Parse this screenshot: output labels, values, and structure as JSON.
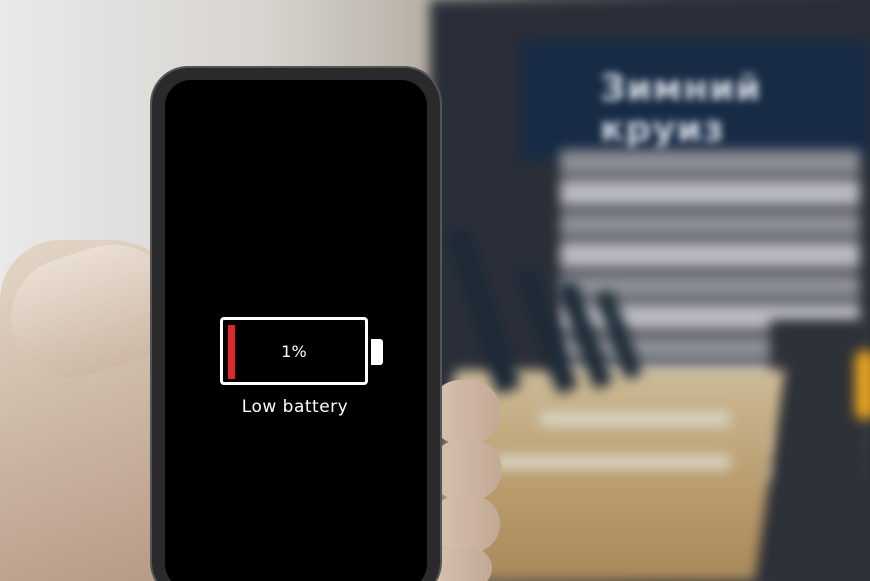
{
  "phone_screen": {
    "battery_percent_label": "1%",
    "battery_level": 0.01,
    "status_text": "Low battery",
    "fill_color": "#e3262a",
    "outline_color": "#ffffff",
    "screen_color": "#000000"
  },
  "background": {
    "store_sign_text": "Зимний круиз",
    "accent_color": "#e9a521"
  }
}
